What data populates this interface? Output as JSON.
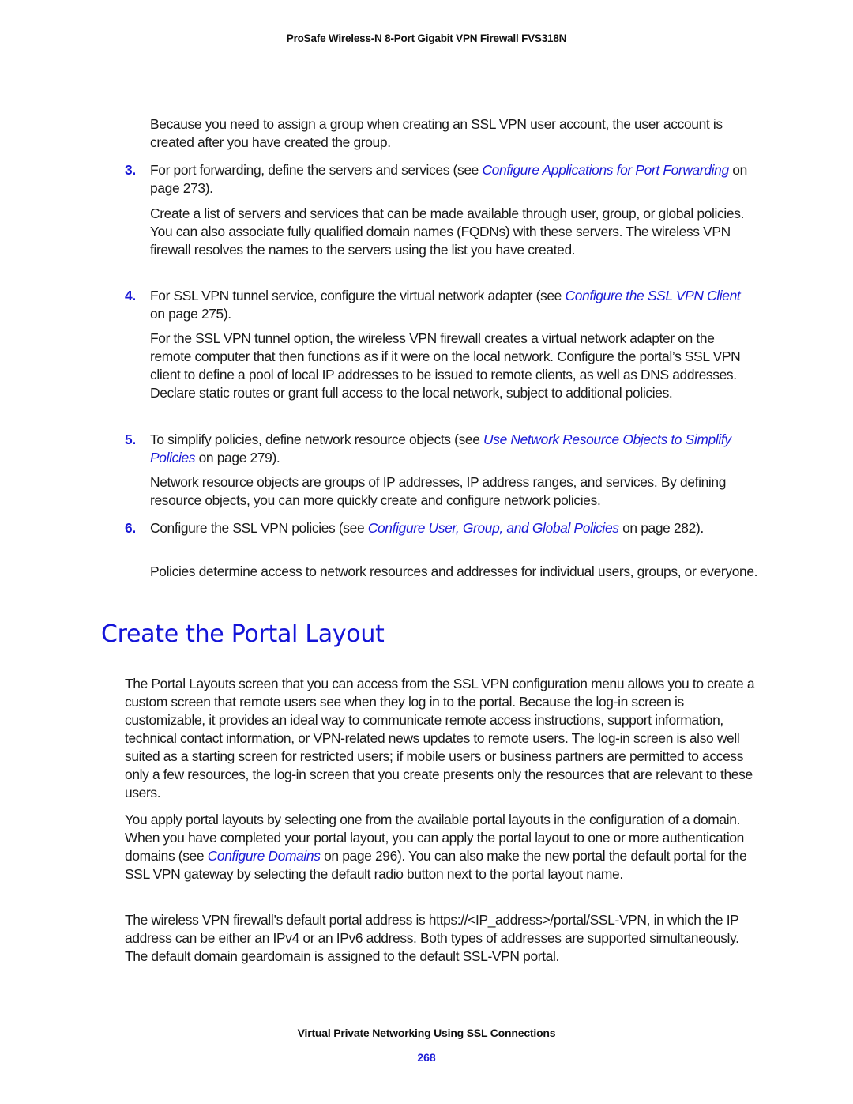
{
  "header": {
    "title": "ProSafe Wireless-N 8-Port Gigabit VPN Firewall FVS318N"
  },
  "intro_paragraph": "Because you need to assign a group when creating an SSL VPN user account, the user account is created after you have created the group.",
  "steps": [
    {
      "number": "3.",
      "text_before": "For port forwarding, define the servers and services (see ",
      "link": "Configure Applications for Port Forwarding",
      "text_after": " on page 273).",
      "detail": "Create a list of servers and services that can be made available through user, group, or global policies. You can also associate fully qualified domain names (FQDNs) with these servers. The wireless VPN firewall resolves the names to the servers using the list you have created."
    },
    {
      "number": "4.",
      "text_before": "For SSL VPN tunnel service, configure the virtual network adapter (see ",
      "link": "Configure the SSL VPN Client",
      "text_after": " on page 275).",
      "detail": "For the SSL VPN tunnel option, the wireless VPN firewall creates a virtual network adapter on the remote computer that then functions as if it were on the local network. Configure the portal’s SSL VPN client to define a pool of local IP addresses to be issued to remote clients, as well as DNS addresses. Declare static routes or grant full access to the local network, subject to additional policies."
    },
    {
      "number": "5.",
      "text_before": "To simplify policies, define network resource objects (see ",
      "link": "Use Network Resource Objects to Simplify Policies",
      "text_after": " on page 279).",
      "detail": "Network resource objects are groups of IP addresses, IP address ranges, and services. By defining resource objects, you can more quickly create and configure network policies."
    },
    {
      "number": "6.",
      "text_before": "Configure the SSL VPN policies (see ",
      "link": "Configure User, Group, and Global Policies",
      "text_after": " on page 282).",
      "detail": "Policies determine access to network resources and addresses for individual users, groups, or everyone."
    }
  ],
  "section": {
    "heading": "Create the Portal Layout",
    "paragraph1": "The Portal Layouts screen that you can access from the SSL VPN configuration menu allows you to create a custom screen that remote users see when they log in to the portal. Because the log-in screen is customizable, it provides an ideal way to communicate remote access instructions, support information, technical contact information, or VPN-related news updates to remote users. The log-in screen is also well suited as a starting screen for restricted users; if mobile users or business partners are permitted to access only a few resources, the log-in screen that you create presents only the resources that are relevant to these users.",
    "paragraph2_before": "You apply portal layouts by selecting one from the available portal layouts in the configuration of a domain. When you have completed your portal layout, you can apply the portal layout to one or more authentication domains (see ",
    "paragraph2_link": "Configure Domains",
    "paragraph2_after": " on page 296). You can also make the new portal the default portal for the SSL VPN gateway by selecting the default radio button next to the portal layout name.",
    "paragraph3": "The wireless VPN firewall’s default portal address is https://<IP_address>/portal/SSL-VPN, in which the IP address can be either an IPv4 or an IPv6 address. Both types of addresses are supported simultaneously. The default domain geardomain is assigned to the default SSL-VPN portal."
  },
  "footer": {
    "chapter_title": "Virtual Private Networking Using SSL Connections",
    "page_number": "268"
  },
  "colors": {
    "accent": "#1a1ad6",
    "heading": "#1414d8",
    "rule": "#6a6af0"
  }
}
